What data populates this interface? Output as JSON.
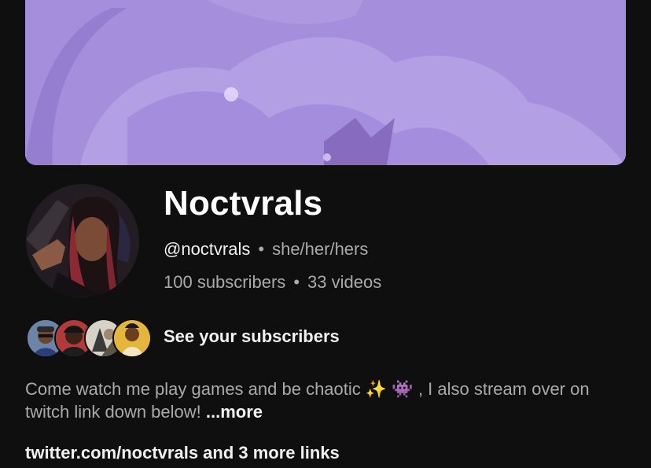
{
  "channel": {
    "name": "Noctvrals",
    "handle": "@noctvrals",
    "pronouns": "she/her/hers",
    "subscribers": "100 subscribers",
    "videos": "33 videos",
    "separator": "•"
  },
  "subscribers_preview": {
    "label": "See your subscribers",
    "avatars": [
      "subscriber-avatar-1",
      "subscriber-avatar-2",
      "subscriber-avatar-3",
      "subscriber-avatar-4"
    ]
  },
  "description": {
    "text_part1": "Come watch me play games and be chaotic ",
    "emoji1": "✨",
    "emoji2": "👾",
    "text_part2": " , I also stream over on twitch link down below! ",
    "more_label": "...more"
  },
  "links": {
    "label": "twitter.com/noctvrals and 3 more links"
  },
  "colors": {
    "background": "#0f0f0f",
    "banner": "#a58fdc",
    "text_primary": "#f1f1f1",
    "text_secondary": "#aaaaaa"
  }
}
